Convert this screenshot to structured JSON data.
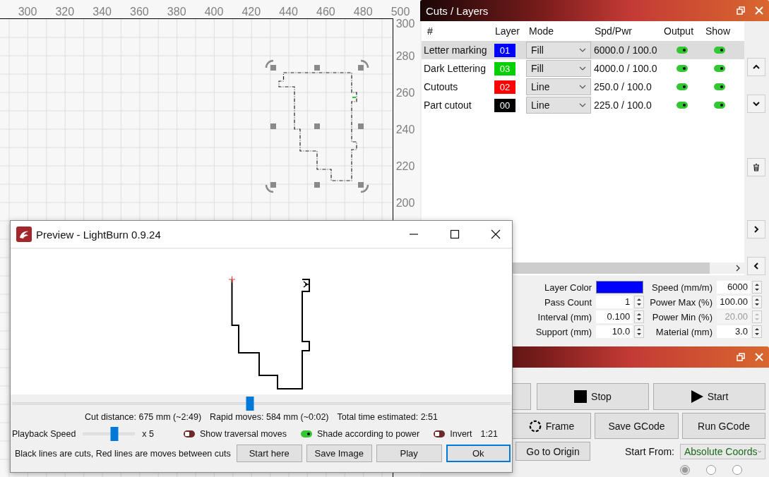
{
  "canvas": {
    "x_ruler": [
      "300",
      "320",
      "340",
      "360",
      "380",
      "400",
      "420",
      "440",
      "460",
      "480",
      "500"
    ],
    "y_ruler": [
      "300",
      "280",
      "260",
      "240",
      "220",
      "200"
    ]
  },
  "cuts_panel": {
    "title": "Cuts / Layers",
    "columns": [
      "#",
      "Layer",
      "Mode",
      "Spd/Pwr",
      "Output",
      "Show"
    ],
    "rows": [
      {
        "name": "Letter marking",
        "layer": "01",
        "color": "#0000ff",
        "mode": "Fill",
        "speed_power": "6000.0 / 100.0",
        "output": true,
        "show": true,
        "selected": true
      },
      {
        "name": "Dark Lettering",
        "layer": "03",
        "color": "#00d000",
        "mode": "Fill",
        "speed_power": "4000.0 / 100.0",
        "output": true,
        "show": true,
        "selected": false
      },
      {
        "name": "Cutouts",
        "layer": "02",
        "color": "#ff0000",
        "mode": "Line",
        "speed_power": "250.0 / 100.0",
        "output": true,
        "show": true,
        "selected": false
      },
      {
        "name": "Part cutout",
        "layer": "00",
        "color": "#000000",
        "mode": "Line",
        "speed_power": "225.0 / 100.0",
        "output": true,
        "show": true,
        "selected": false
      }
    ],
    "settings": [
      {
        "label": "Layer Color",
        "kind": "color"
      },
      {
        "label": "Speed (mm/m)",
        "kind": "spin",
        "value": "6000",
        "disabled": false
      },
      {
        "label": "Pass Count",
        "kind": "spin",
        "value": "1",
        "disabled": false
      },
      {
        "label": "Power Max (%)",
        "kind": "spin",
        "value": "100.00",
        "disabled": false
      },
      {
        "label": "Interval (mm)",
        "kind": "spin",
        "value": "0.100",
        "disabled": false
      },
      {
        "label": "Power Min (%)",
        "kind": "spin",
        "value": "20.00",
        "disabled": true
      },
      {
        "label": "Support (mm)",
        "kind": "spin",
        "value": "10.0",
        "disabled": false
      },
      {
        "label": "Material (mm)",
        "kind": "spin",
        "value": "3.0",
        "disabled": false
      }
    ]
  },
  "laser_panel": {
    "buttons": [
      {
        "kind": "blank"
      },
      {
        "kind": "stop",
        "label": "Stop"
      },
      {
        "kind": "start",
        "label": "Start"
      },
      {
        "kind": "frame",
        "label": "Frame"
      },
      {
        "kind": "text",
        "label": "Save GCode"
      },
      {
        "kind": "text",
        "label": "Run GCode"
      }
    ],
    "origin_button": "Go to Origin",
    "start_from": {
      "label": "Start From:",
      "value": "Absolute Coords"
    },
    "job_origin_radios": [
      {
        "selected": true
      },
      {
        "selected": false
      },
      {
        "selected": false
      }
    ]
  },
  "preview": {
    "title": "Preview - LightBurn 0.9.24",
    "timeline": {
      "level": 0.477
    },
    "stats": [
      "Cut distance: 675 mm (~2:49)",
      "Rapid moves: 584 mm (~0:02)",
      "Total time estimated: 2:51"
    ],
    "playback": {
      "label": "Playback Speed",
      "level": 0.6,
      "multiplier": "x 5"
    },
    "toggles": [
      {
        "label": "Show traversal moves",
        "on": false
      },
      {
        "label": "Shade according to power",
        "on": true
      },
      {
        "label": "Invert",
        "on": false
      }
    ],
    "position": "1:21",
    "hint": "Black lines are cuts, Red lines are moves between cuts",
    "buttons": [
      {
        "label": "Start here",
        "default": false
      },
      {
        "label": "Save Image",
        "default": false
      },
      {
        "label": "Play",
        "default": false
      },
      {
        "label": "Ok",
        "default": true
      }
    ]
  }
}
